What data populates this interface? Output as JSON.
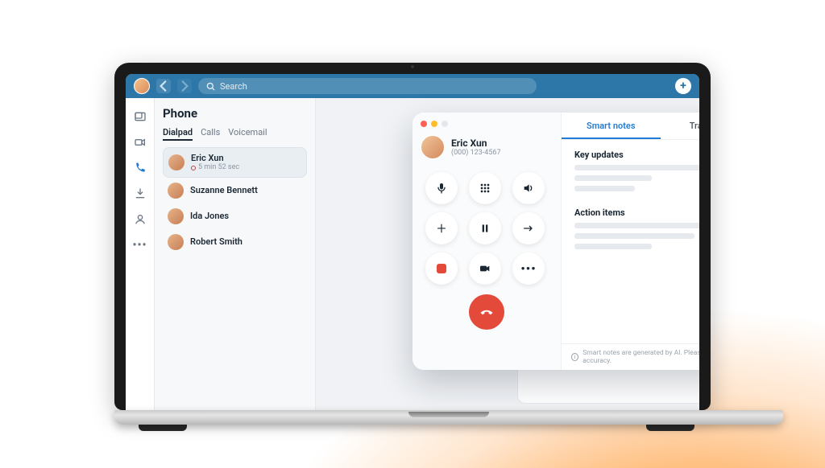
{
  "colors": {
    "brand": "#2c77a8",
    "accent": "#1f7bd6",
    "danger": "#e44a3a"
  },
  "topbar": {
    "search_placeholder": "Search",
    "add_label": "+"
  },
  "rail": {
    "items": [
      {
        "name": "inbox-icon"
      },
      {
        "name": "video-icon"
      },
      {
        "name": "phone-icon",
        "active": true
      },
      {
        "name": "download-icon"
      },
      {
        "name": "person-icon"
      },
      {
        "name": "more-icon"
      }
    ]
  },
  "phone_panel": {
    "title": "Phone",
    "tabs": [
      "Dialpad",
      "Calls",
      "Voicemail"
    ],
    "active_tab": 0,
    "contacts": [
      {
        "name": "Eric Xun",
        "sub": "5 min 52 sec",
        "recording": true,
        "selected": true
      },
      {
        "name": "Suzanne Bennett"
      },
      {
        "name": "Ida Jones"
      },
      {
        "name": "Robert Smith"
      }
    ]
  },
  "call": {
    "caller_name": "Eric Xun",
    "caller_number": "(000) 123-4567",
    "buttons": {
      "mute": "mute-icon",
      "dialpad": "dialpad-icon",
      "speaker": "speaker-icon",
      "add": "add-call-icon",
      "hold": "hold-icon",
      "transfer": "transfer-icon",
      "record": "record-icon",
      "video": "video-icon",
      "more": "more-icon",
      "hangup": "hangup-icon"
    },
    "tabs": {
      "smart_notes": "Smart notes",
      "transcript": "Transcript",
      "active": "smart_notes"
    },
    "sections": {
      "key_updates": "Key updates",
      "action_items": "Action items"
    },
    "ai_disclaimer": "Smart notes are generated by AI. Please review for accuracy."
  }
}
